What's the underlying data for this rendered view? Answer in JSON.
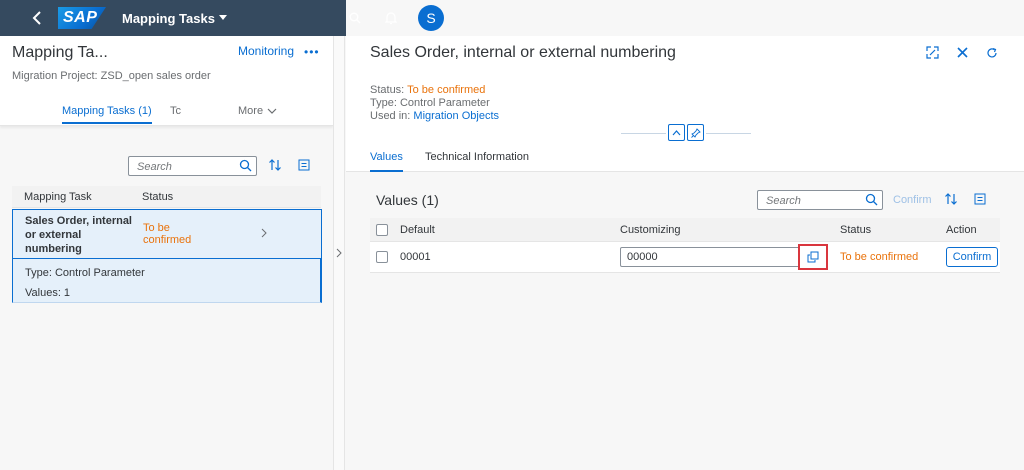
{
  "shell": {
    "brand": "SAP",
    "app_title": "Mapping Tasks",
    "user_initial": "S"
  },
  "left": {
    "title": "Mapping Ta...",
    "monitoring": "Monitoring",
    "more_dots": "•••",
    "subtitle": "Migration Project: ZSD_open sales order",
    "tabs": [
      {
        "label": "Mapping Tasks (1)"
      },
      {
        "label": "Tc"
      },
      {
        "label": "More"
      }
    ],
    "search_placeholder": "Search",
    "columns": [
      "Mapping Task",
      "Status"
    ],
    "row": {
      "name": "Sales Order, internal or external numbering",
      "status": "To be confirmed"
    },
    "details": {
      "type": "Type:  Control Parameter",
      "values": "Values:  1"
    }
  },
  "right": {
    "title": "Sales Order, internal or external numbering",
    "status_label": "Status: ",
    "status_value": "To be confirmed",
    "type_line": "Type: Control Parameter",
    "used_label": "Used in: ",
    "used_value": "Migration Objects",
    "tabs": [
      {
        "label": "Values"
      },
      {
        "label": "Technical Information"
      }
    ],
    "values_title": "Values (1)",
    "search_placeholder": "Search",
    "confirm_toolbar": "Confirm",
    "columns": [
      "Default",
      "Customizing",
      "Status",
      "Action"
    ],
    "row": {
      "default": "00001",
      "customizing": "00000",
      "status": "To be confirmed",
      "action": "Confirm"
    }
  },
  "colors": {
    "shell": "#354a5f",
    "accent": "#0a6ed1",
    "warning": "#e9730c",
    "highlight": "#d9363e"
  }
}
